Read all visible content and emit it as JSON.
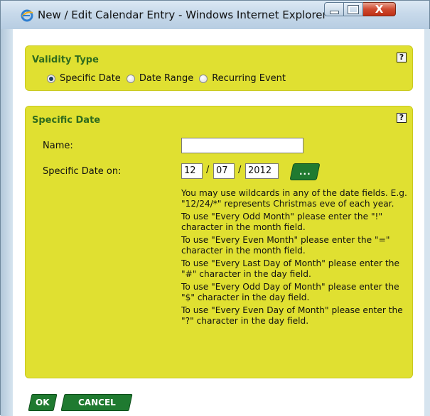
{
  "window": {
    "title": "New / Edit Calendar Entry - Windows Internet Explorer",
    "minimize_icon": "minimize-icon",
    "maximize_icon": "maximize-icon",
    "close_icon": "close-icon",
    "close_glyph": "X"
  },
  "validity": {
    "title": "Validity Type",
    "help_label": "?",
    "options": [
      {
        "label": "Specific Date",
        "checked": true
      },
      {
        "label": "Date Range",
        "checked": false
      },
      {
        "label": "Recurring Event",
        "checked": false
      }
    ]
  },
  "specific": {
    "title": "Specific Date",
    "help_label": "?",
    "name_label": "Name:",
    "name_value": "",
    "date_label": "Specific Date on:",
    "month": "12",
    "day": "07",
    "year": "2012",
    "separator": "/",
    "calendar_button_label": "...",
    "help_lines": [
      "You may use wildcards in any of the date fields. E.g. \"12/24/*\" represents Christmas eve of each year.",
      "To use \"Every Odd Month\" please enter the \"!\" character in the month field.",
      "To use \"Every Even Month\" please enter the \"=\" character in the month field.",
      "To use \"Every Last Day of Month\" please enter the \"#\" character in the day field.",
      "To use \"Every Odd Day of Month\" please enter the \"$\" character in the day field.",
      "To use \"Every Even Day of Month\" please enter the \"?\" character in the day field."
    ]
  },
  "actions": {
    "ok_label": "OK",
    "cancel_label": "CANCEL"
  },
  "colors": {
    "panel": "#e0e031",
    "panel_title": "#2f6b1e",
    "button": "#1f7a30"
  }
}
